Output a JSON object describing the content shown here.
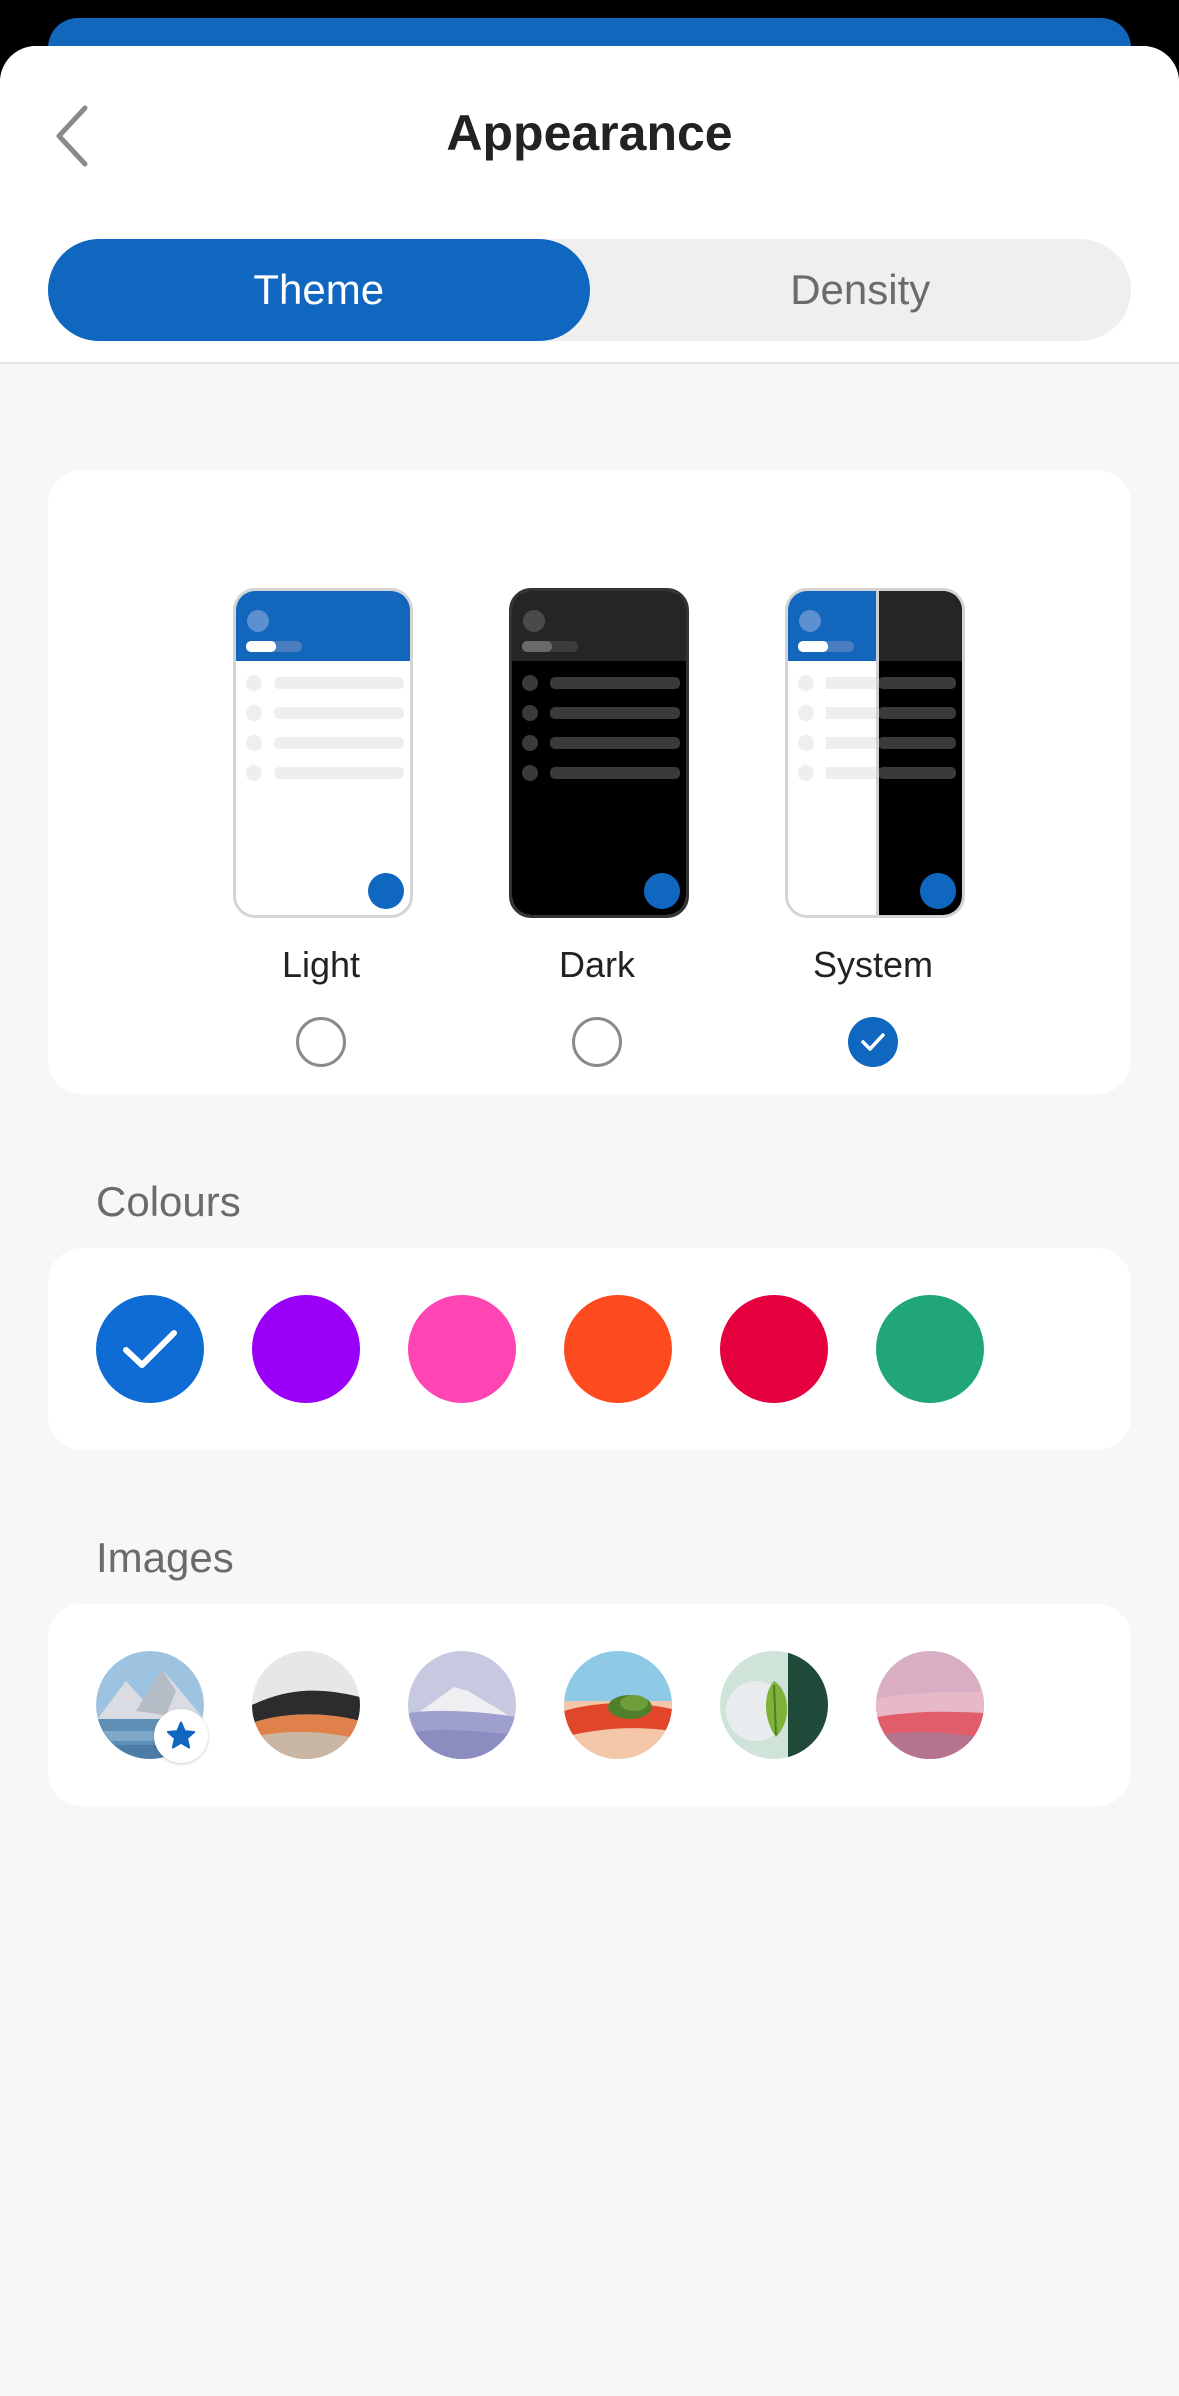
{
  "header": {
    "title": "Appearance",
    "back_icon": "chevron-left-icon"
  },
  "tabs": [
    {
      "label": "Theme",
      "active": true
    },
    {
      "label": "Density",
      "active": false
    }
  ],
  "themes": [
    {
      "label": "Light",
      "selected": false
    },
    {
      "label": "Dark",
      "selected": false
    },
    {
      "label": "System",
      "selected": true
    }
  ],
  "colours": {
    "label": "Colours",
    "items": [
      {
        "name": "blue",
        "hex": "#0f6cd4",
        "selected": true
      },
      {
        "name": "purple",
        "hex": "#9a00f7",
        "selected": false
      },
      {
        "name": "pink",
        "hex": "#ff45b4",
        "selected": false
      },
      {
        "name": "orange",
        "hex": "#fd4a1f",
        "selected": false
      },
      {
        "name": "red",
        "hex": "#e5003e",
        "selected": false
      },
      {
        "name": "green",
        "hex": "#20a67a",
        "selected": false
      }
    ]
  },
  "images": {
    "label": "Images",
    "items": [
      {
        "name": "mountain-lake",
        "starred": true
      },
      {
        "name": "desert-dunes",
        "starred": false
      },
      {
        "name": "misty-mountain",
        "starred": false
      },
      {
        "name": "red-plant",
        "starred": false
      },
      {
        "name": "green-leaf",
        "starred": false
      },
      {
        "name": "pink-sunset",
        "starred": false
      }
    ]
  },
  "accent_color": "#0f67bf"
}
